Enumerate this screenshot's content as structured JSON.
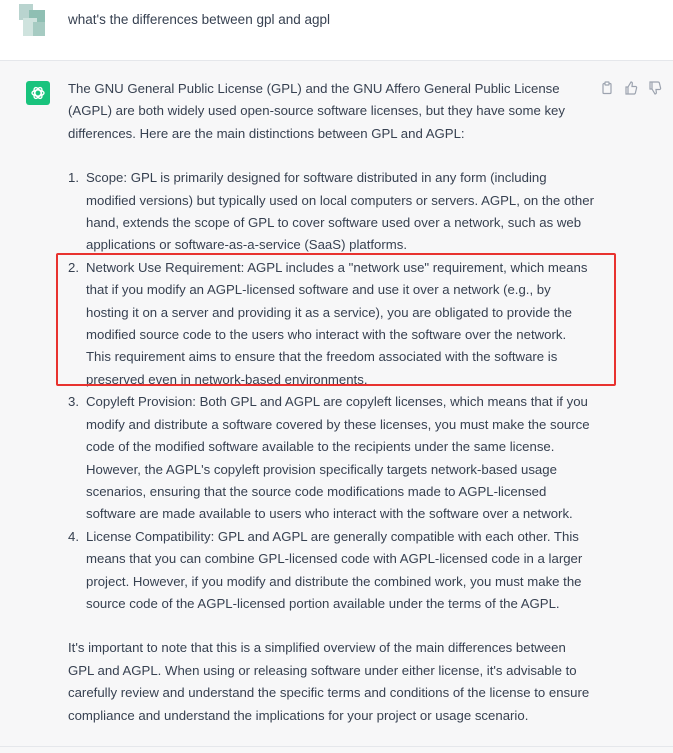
{
  "conversation": {
    "user_message": "what's the differences between gpl and agpl",
    "assistant": {
      "intro": "The GNU General Public License (GPL) and the GNU Affero General Public License (AGPL) are both widely used open-source software licenses, but they have some key differences. Here are the main distinctions between GPL and AGPL:",
      "items": [
        {
          "num": "1.",
          "text": "Scope: GPL is primarily designed for software distributed in any form (including modified versions) but typically used on local computers or servers. AGPL, on the other hand, extends the scope of GPL to cover software used over a network, such as web applications or software-as-a-service (SaaS) platforms."
        },
        {
          "num": "2.",
          "text": "Network Use Requirement: AGPL includes a \"network use\" requirement, which means that if you modify an AGPL-licensed software and use it over a network (e.g., by hosting it on a server and providing it as a service), you are obligated to provide the modified source code to the users who interact with the software over the network. This requirement aims to ensure that the freedom associated with the software is preserved even in network-based environments."
        },
        {
          "num": "3.",
          "text": "Copyleft Provision: Both GPL and AGPL are copyleft licenses, which means that if you modify and distribute a software covered by these licenses, you must make the source code of the modified software available to the recipients under the same license. However, the AGPL's copyleft provision specifically targets network-based usage scenarios, ensuring that the source code modifications made to AGPL-licensed software are made available to users who interact with the software over a network."
        },
        {
          "num": "4.",
          "text": "License Compatibility: GPL and AGPL are generally compatible with each other. This means that you can combine GPL-licensed code with AGPL-licensed code in a larger project. However, if you modify and distribute the combined work, you must make the source code of the AGPL-licensed portion available under the terms of the AGPL."
        }
      ],
      "outro": "It's important to note that this is a simplified overview of the main differences between GPL and AGPL. When using or releasing software under either license, it's advisable to carefully review and understand the specific terms and conditions of the license to ensure compliance and understand the implications for your project or usage scenario."
    }
  },
  "icons": {
    "assistant_avatar": "openai-logo-icon",
    "copy": "clipboard-icon",
    "thumbs_up": "thumbs-up-icon",
    "thumbs_down": "thumbs-down-icon"
  },
  "colors": {
    "assistant_avatar_bg": "#19c37d",
    "highlight_box": "#e8322f",
    "assistant_bg": "#f7f7f8"
  }
}
